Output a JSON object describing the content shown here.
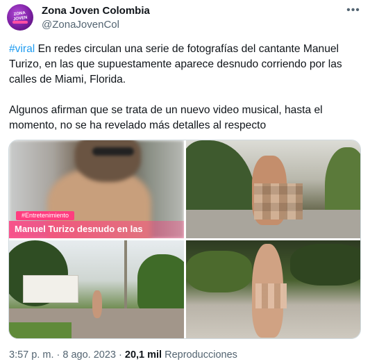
{
  "account": {
    "display_name": "Zona Joven Colombia",
    "handle": "@ZonaJovenCol",
    "avatar_logo_text": "ZONA JOVEN",
    "more_icon": "more-horizontal-icon"
  },
  "tweet": {
    "hashtag": "#viral",
    "paragraph1_rest": " En redes circulan una serie de fotografías del cantante Manuel Turizo, en las que supuestamente aparece desnudo corriendo por las calles de Miami, Florida.",
    "paragraph2": "Algunos afirman que se trata de un nuevo video musical, hasta el momento, no se ha revelado más detalles al respecto"
  },
  "media": {
    "tile1_label": "#Entretenimiento",
    "tile1_caption": "Manuel Turizo desnudo en las"
  },
  "meta": {
    "time": "3:57 p. m.",
    "separator1": " · ",
    "date": "8 ago. 2023",
    "separator2": " · ",
    "views_count": "20,1 mil",
    "views_label": " Reproducciones"
  },
  "colors": {
    "link": "#1d9bf0",
    "text": "#0f1419",
    "secondary": "#536471",
    "accent_pink": "#ff3d7f"
  }
}
